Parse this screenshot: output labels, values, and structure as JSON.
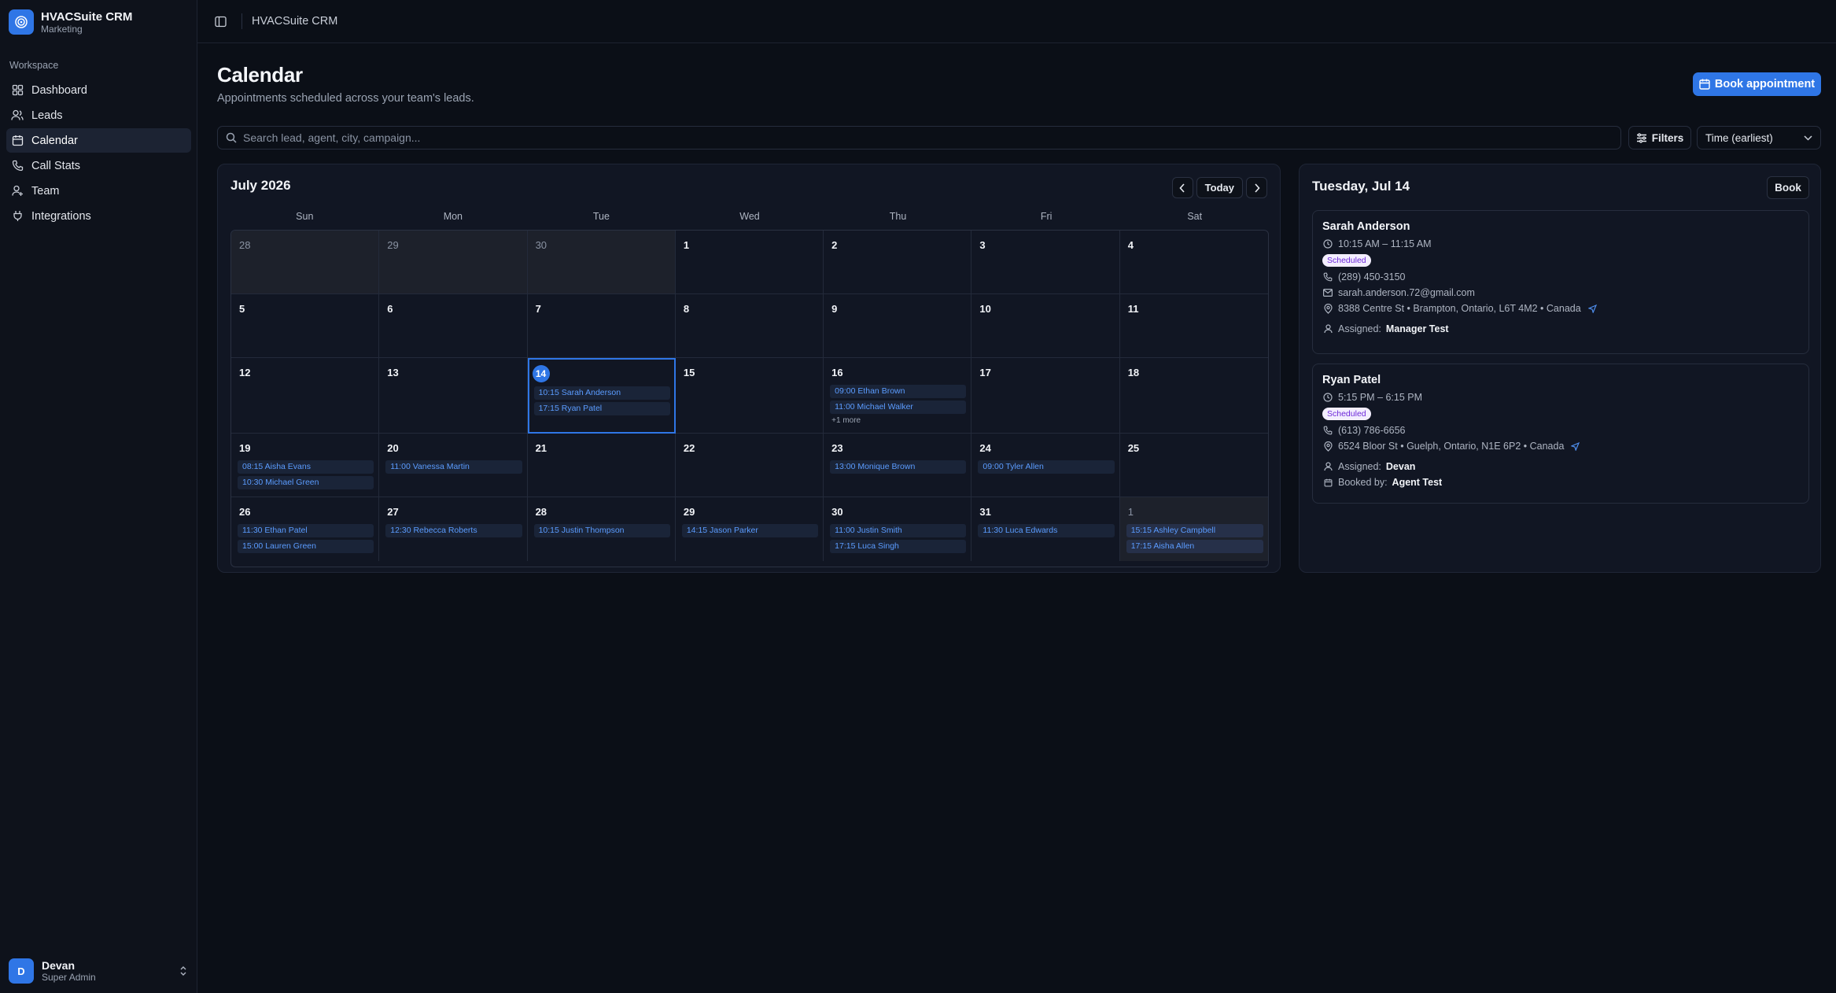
{
  "app": {
    "name": "HVACSuite CRM",
    "workspace_sub": "Marketing"
  },
  "sidebar": {
    "section_label": "Workspace",
    "items": [
      {
        "label": "Dashboard",
        "icon": "dashboard-icon"
      },
      {
        "label": "Leads",
        "icon": "users-icon"
      },
      {
        "label": "Calendar",
        "icon": "calendar-icon",
        "active": true
      },
      {
        "label": "Call Stats",
        "icon": "phone-icon"
      },
      {
        "label": "Team",
        "icon": "team-icon"
      },
      {
        "label": "Integrations",
        "icon": "plug-icon"
      }
    ],
    "user": {
      "initial": "D",
      "name": "Devan",
      "role": "Super Admin"
    }
  },
  "topbar": {
    "title": "HVACSuite CRM"
  },
  "header": {
    "title": "Calendar",
    "subtitle": "Appointments scheduled across your team's leads.",
    "book_button": "Book appointment"
  },
  "search": {
    "placeholder": "Search lead, agent, city, campaign..."
  },
  "filters": {
    "label": "Filters"
  },
  "sort": {
    "value": "Time (earliest)"
  },
  "calendar": {
    "month_label": "July 2026",
    "today_label": "Today",
    "weekdays": [
      "Sun",
      "Mon",
      "Tue",
      "Wed",
      "Thu",
      "Fri",
      "Sat"
    ],
    "weeks": [
      [
        {
          "day": "28",
          "outside": true,
          "events": []
        },
        {
          "day": "29",
          "outside": true,
          "events": []
        },
        {
          "day": "30",
          "outside": true,
          "events": []
        },
        {
          "day": "1",
          "events": []
        },
        {
          "day": "2",
          "events": []
        },
        {
          "day": "3",
          "events": []
        },
        {
          "day": "4",
          "events": []
        }
      ],
      [
        {
          "day": "5",
          "events": []
        },
        {
          "day": "6",
          "events": []
        },
        {
          "day": "7",
          "events": []
        },
        {
          "day": "8",
          "events": []
        },
        {
          "day": "9",
          "events": []
        },
        {
          "day": "10",
          "events": []
        },
        {
          "day": "11",
          "events": []
        }
      ],
      [
        {
          "day": "12",
          "events": []
        },
        {
          "day": "13",
          "events": []
        },
        {
          "day": "14",
          "selected": true,
          "today": true,
          "events": [
            "10:15 Sarah Anderson",
            "17:15 Ryan Patel"
          ]
        },
        {
          "day": "15",
          "events": []
        },
        {
          "day": "16",
          "events": [
            "09:00 Ethan Brown",
            "11:00 Michael Walker"
          ],
          "more": "+1 more"
        },
        {
          "day": "17",
          "events": []
        },
        {
          "day": "18",
          "events": []
        }
      ],
      [
        {
          "day": "19",
          "events": [
            "08:15 Aisha Evans",
            "10:30 Michael Green"
          ]
        },
        {
          "day": "20",
          "events": [
            "11:00 Vanessa Martin"
          ]
        },
        {
          "day": "21",
          "events": []
        },
        {
          "day": "22",
          "events": []
        },
        {
          "day": "23",
          "events": [
            "13:00 Monique Brown"
          ]
        },
        {
          "day": "24",
          "events": [
            "09:00 Tyler Allen"
          ]
        },
        {
          "day": "25",
          "events": []
        }
      ],
      [
        {
          "day": "26",
          "events": [
            "11:30 Ethan Patel",
            "15:00 Lauren Green"
          ]
        },
        {
          "day": "27",
          "events": [
            "12:30 Rebecca Roberts"
          ]
        },
        {
          "day": "28",
          "events": [
            "10:15 Justin Thompson"
          ]
        },
        {
          "day": "29",
          "events": [
            "14:15 Jason Parker"
          ]
        },
        {
          "day": "30",
          "events": [
            "11:00 Justin Smith",
            "17:15 Luca Singh"
          ]
        },
        {
          "day": "31",
          "events": [
            "11:30 Luca Edwards"
          ]
        },
        {
          "day": "1",
          "outside": true,
          "events": [
            "15:15 Ashley Campbell",
            "17:15 Aisha Allen"
          ]
        }
      ]
    ]
  },
  "day_panel": {
    "title": "Tuesday, Jul 14",
    "book_label": "Book",
    "appointments": [
      {
        "name": "Sarah Anderson",
        "time": "10:15 AM – 11:15 AM",
        "status": "Scheduled",
        "phone": "(289) 450-3150",
        "email": "sarah.anderson.72@gmail.com",
        "address": "8388 Centre St • Brampton, Ontario, L6T 4M2 • Canada",
        "assigned_label": "Assigned:",
        "assigned": "Manager Test"
      },
      {
        "name": "Ryan Patel",
        "time": "5:15 PM – 6:15 PM",
        "status": "Scheduled",
        "phone": "(613) 786-6656",
        "address": "6524 Bloor St • Guelph, Ontario, N1E 6P2 • Canada",
        "assigned_label": "Assigned:",
        "assigned": "Devan",
        "booked_label": "Booked by:",
        "booked_by": "Agent Test"
      }
    ]
  },
  "colors": {
    "accent": "#2f76e6",
    "background": "#0b0f17",
    "event_text": "#5b9cff",
    "badge_text": "#6d28d9"
  }
}
